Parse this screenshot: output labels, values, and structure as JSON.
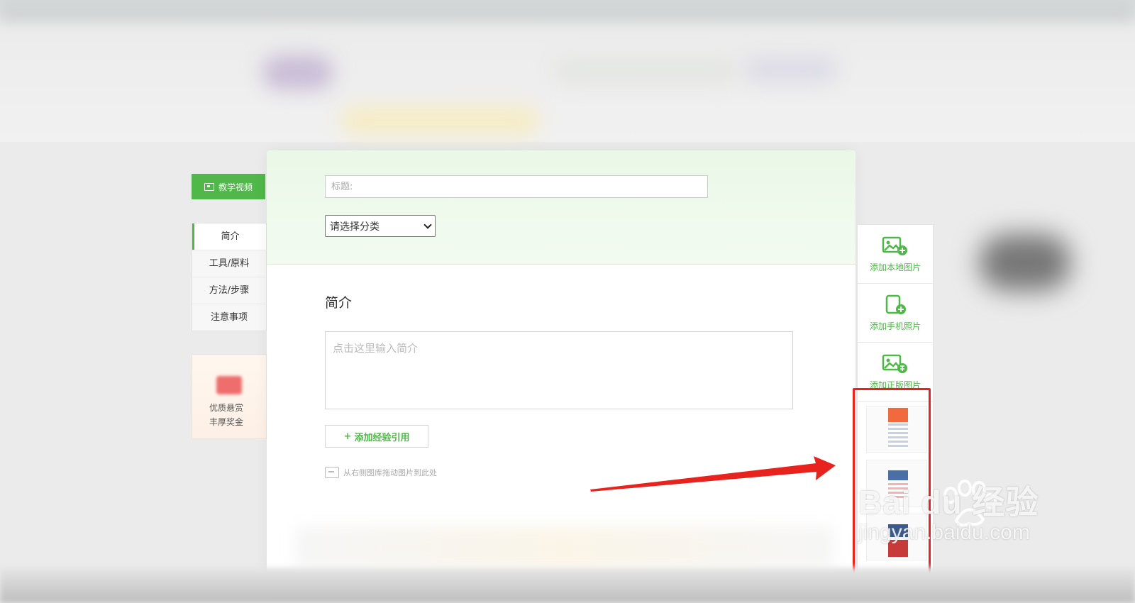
{
  "sidebar": {
    "video_label": "教学视频",
    "nav_items": [
      {
        "label": "简介"
      },
      {
        "label": "工具/原料"
      },
      {
        "label": "方法/步骤"
      },
      {
        "label": "注意事项"
      }
    ],
    "promo_line1": "优质悬赏",
    "promo_line2": "丰厚奖金"
  },
  "editor": {
    "title_placeholder": "标题:",
    "category_selected": "请选择分类",
    "section_title": "简介",
    "intro_placeholder": "点击这里输入简介",
    "add_reference_label": "添加经验引用",
    "drag_hint": "从右侧图库拖动图片到此处"
  },
  "image_panel": {
    "add_local": "添加本地图片",
    "add_phone": "添加手机照片",
    "add_licensed": "添加正版图片"
  },
  "watermark": {
    "brand": "Bai du 经验",
    "url": "jingyan.baidu.com"
  },
  "colors": {
    "accent": "#4fb848",
    "annotation": "#e8231e"
  }
}
